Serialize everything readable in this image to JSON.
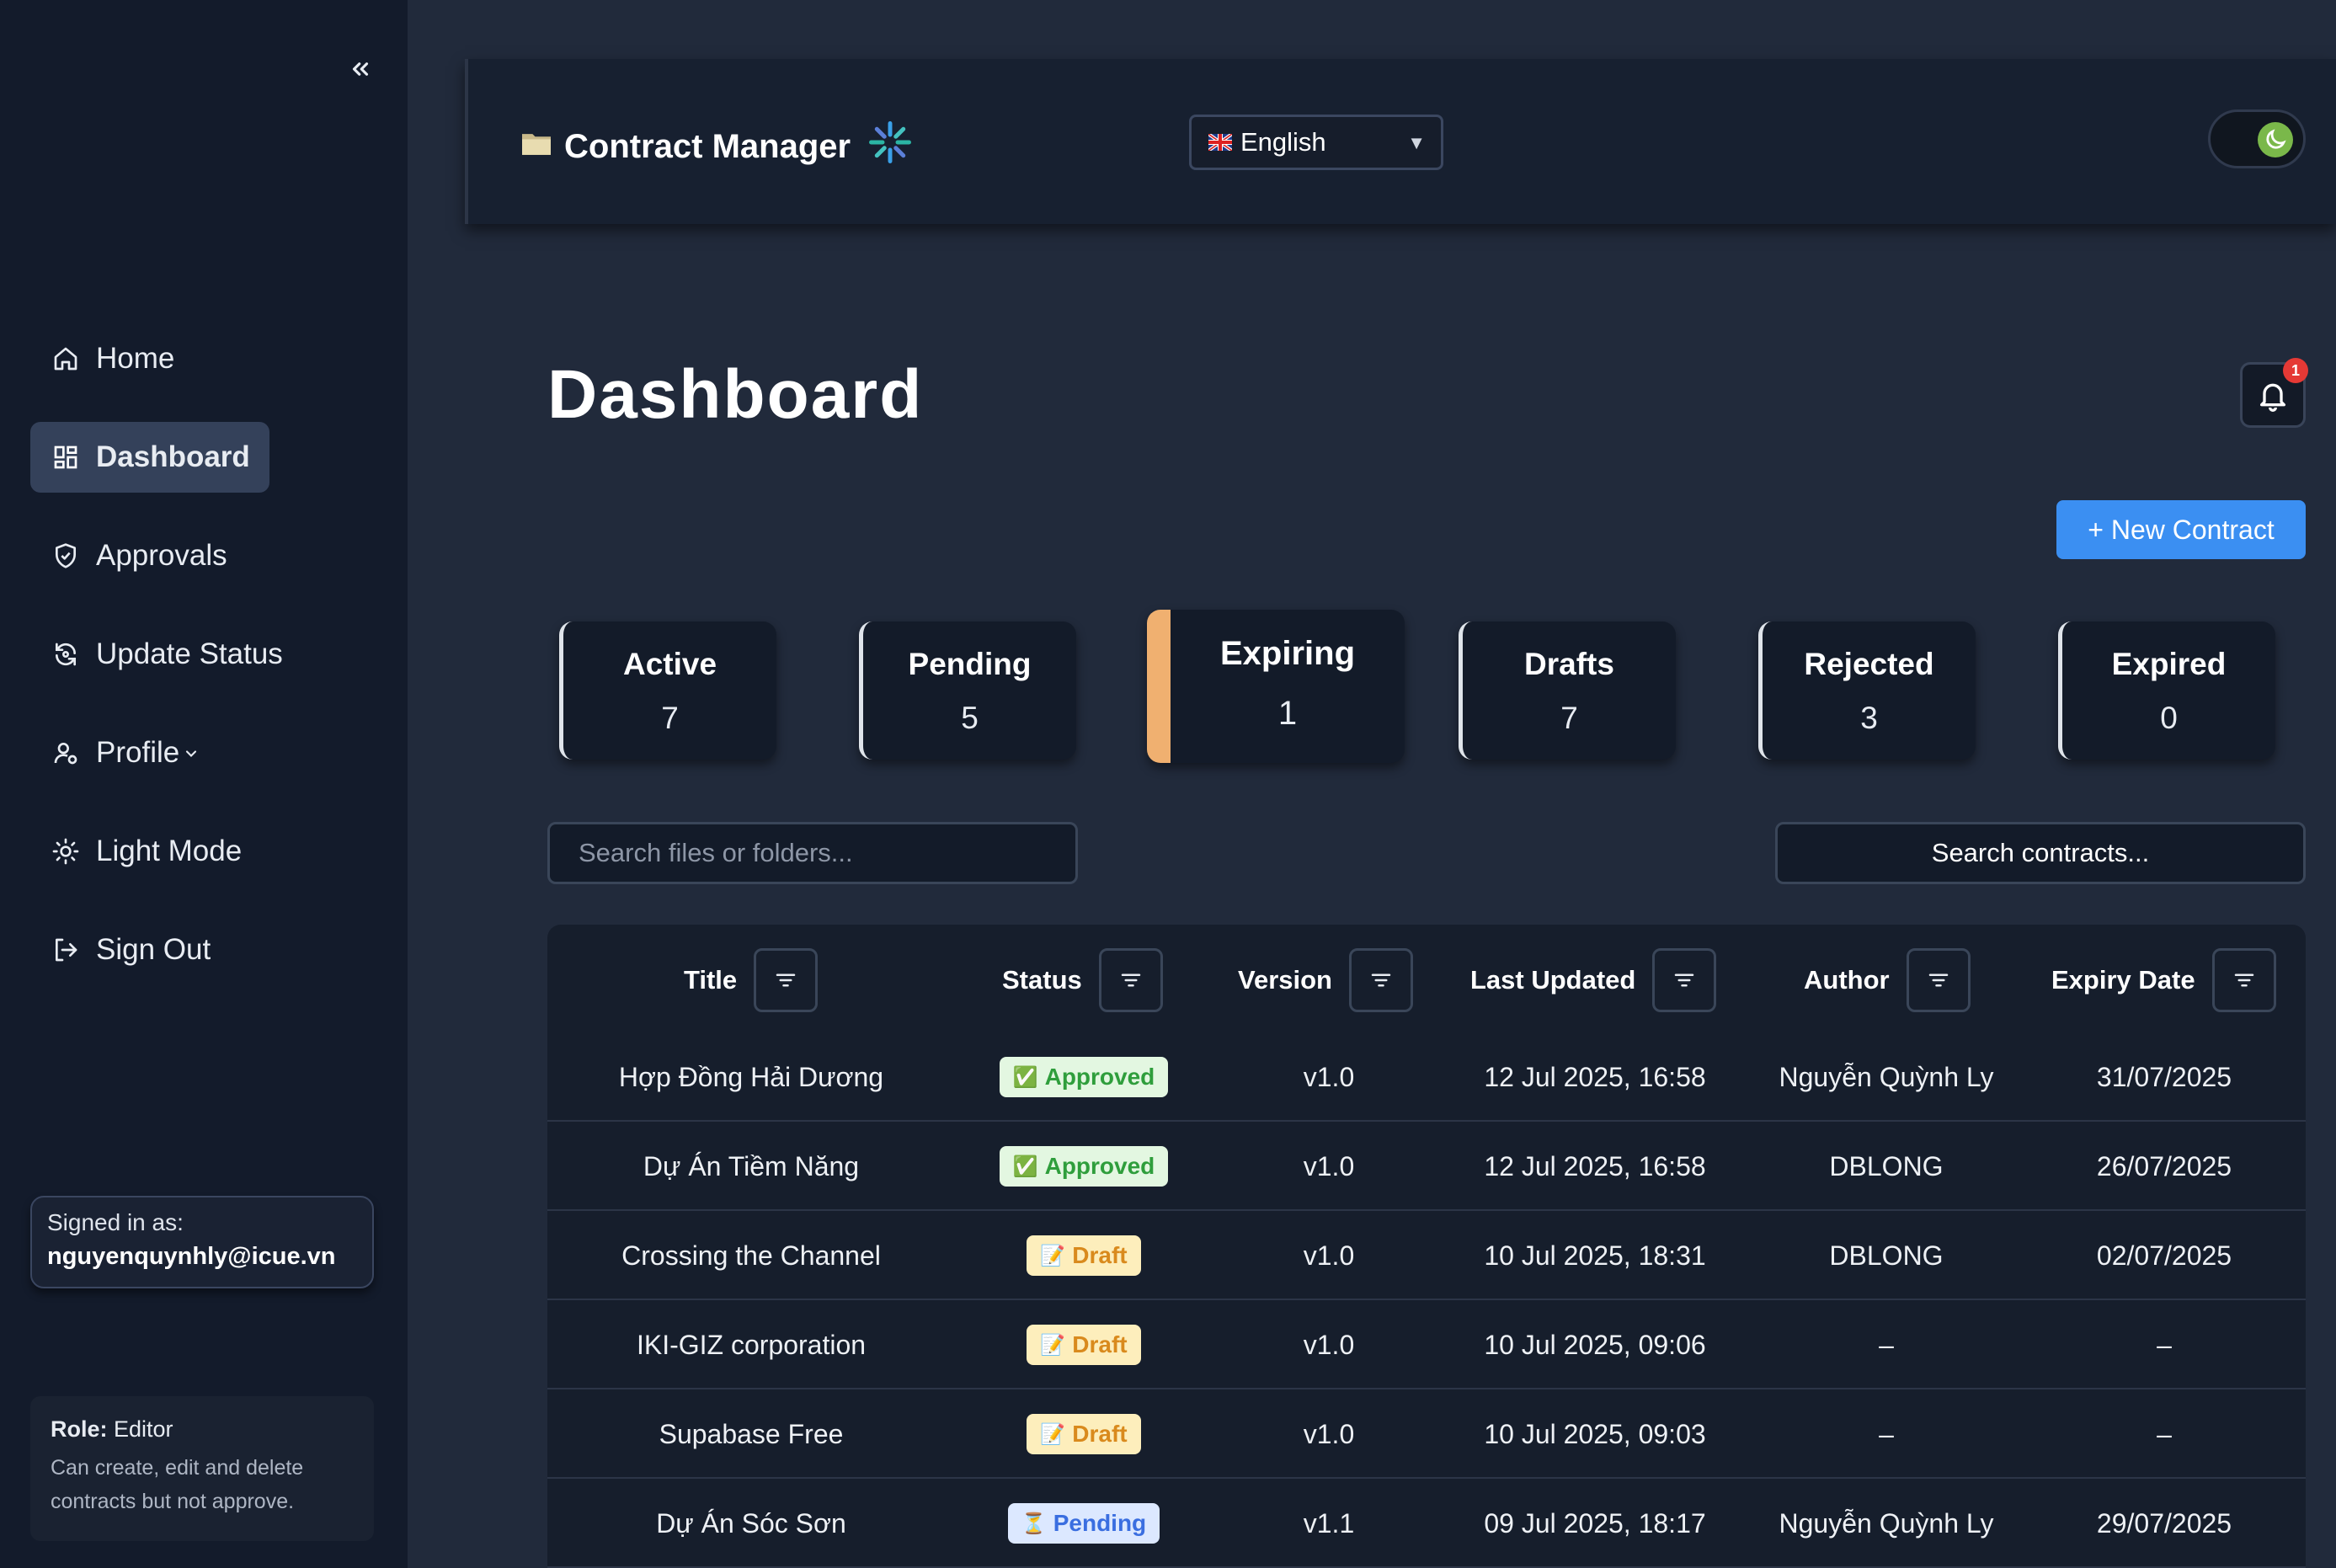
{
  "sidebar": {
    "items": [
      {
        "label": "Home",
        "icon": "home-icon"
      },
      {
        "label": "Dashboard",
        "icon": "dashboard-icon"
      },
      {
        "label": "Approvals",
        "icon": "shield-check-icon"
      },
      {
        "label": "Update Status",
        "icon": "refresh-icon"
      },
      {
        "label": "Profile",
        "icon": "user-gear-icon"
      },
      {
        "label": "Light Mode",
        "icon": "sun-icon"
      },
      {
        "label": "Sign Out",
        "icon": "sign-out-icon"
      }
    ],
    "active": "Dashboard",
    "signed_label": "Signed in as:",
    "signed_email": "nguyenquynhly@icue.vn",
    "role_label": "Role:",
    "role_value": "Editor",
    "role_desc": "Can create, edit and delete contracts but not approve."
  },
  "header": {
    "app_title": "Contract Manager",
    "language": "English"
  },
  "page": {
    "title": "Dashboard",
    "notification_count": "1",
    "new_button": "+ New Contract"
  },
  "stats": [
    {
      "label": "Active",
      "value": "7"
    },
    {
      "label": "Pending",
      "value": "5"
    },
    {
      "label": "Expiring",
      "value": "1"
    },
    {
      "label": "Drafts",
      "value": "7"
    },
    {
      "label": "Rejected",
      "value": "3"
    },
    {
      "label": "Expired",
      "value": "0"
    }
  ],
  "search": {
    "files_placeholder": "Search files or folders...",
    "contracts_placeholder": "Search contracts..."
  },
  "table": {
    "columns": [
      "Title",
      "Status",
      "Version",
      "Last Updated",
      "Author",
      "Expiry Date"
    ],
    "rows": [
      {
        "title": "Hợp Đồng Hải Dương",
        "status": "Approved",
        "status_icon": "✅",
        "version": "v1.0",
        "updated": "12 Jul 2025, 16:58",
        "author": "Nguyễn Quỳnh Ly",
        "expiry": "31/07/2025"
      },
      {
        "title": "Dự Án Tiềm Năng",
        "status": "Approved",
        "status_icon": "✅",
        "version": "v1.0",
        "updated": "12 Jul 2025, 16:58",
        "author": "DBLONG",
        "expiry": "26/07/2025"
      },
      {
        "title": "Crossing the Channel",
        "status": "Draft",
        "status_icon": "📝",
        "version": "v1.0",
        "updated": "10 Jul 2025, 18:31",
        "author": "DBLONG",
        "expiry": "02/07/2025"
      },
      {
        "title": "IKI-GIZ corporation",
        "status": "Draft",
        "status_icon": "📝",
        "version": "v1.0",
        "updated": "10 Jul 2025, 09:06",
        "author": "–",
        "expiry": "–"
      },
      {
        "title": "Supabase Free",
        "status": "Draft",
        "status_icon": "📝",
        "version": "v1.0",
        "updated": "10 Jul 2025, 09:03",
        "author": "–",
        "expiry": "–"
      },
      {
        "title": "Dự Án Sóc Sơn",
        "status": "Pending",
        "status_icon": "⏳",
        "version": "v1.1",
        "updated": "09 Jul 2025, 18:17",
        "author": "Nguyễn Quỳnh Ly",
        "expiry": "29/07/2025"
      }
    ]
  },
  "colors": {
    "accent": "#3b8ff2",
    "expiring": "#f0b070",
    "approved_bg": "#e3f7e1",
    "draft_bg": "#fdeebc",
    "pending_bg": "#dce8ff"
  }
}
